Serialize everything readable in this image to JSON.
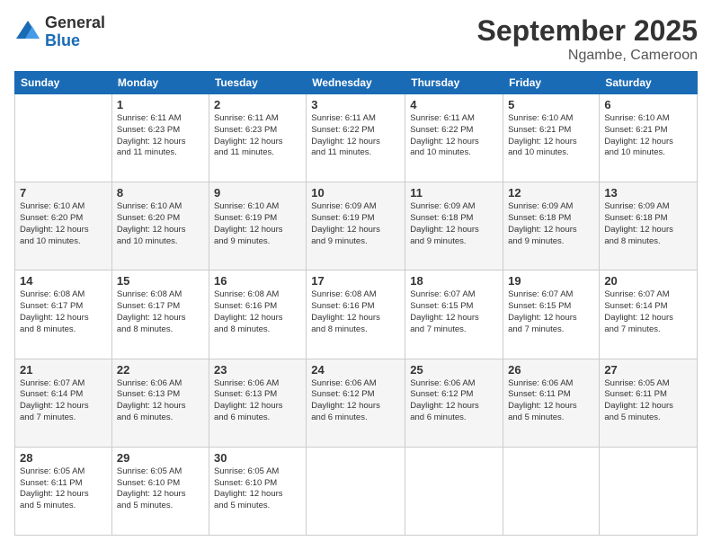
{
  "logo": {
    "general": "General",
    "blue": "Blue"
  },
  "title": "September 2025",
  "location": "Ngambe, Cameroon",
  "days_header": [
    "Sunday",
    "Monday",
    "Tuesday",
    "Wednesday",
    "Thursday",
    "Friday",
    "Saturday"
  ],
  "weeks": [
    [
      {
        "day": "",
        "info": ""
      },
      {
        "day": "1",
        "info": "Sunrise: 6:11 AM\nSunset: 6:23 PM\nDaylight: 12 hours\nand 11 minutes."
      },
      {
        "day": "2",
        "info": "Sunrise: 6:11 AM\nSunset: 6:23 PM\nDaylight: 12 hours\nand 11 minutes."
      },
      {
        "day": "3",
        "info": "Sunrise: 6:11 AM\nSunset: 6:22 PM\nDaylight: 12 hours\nand 11 minutes."
      },
      {
        "day": "4",
        "info": "Sunrise: 6:11 AM\nSunset: 6:22 PM\nDaylight: 12 hours\nand 10 minutes."
      },
      {
        "day": "5",
        "info": "Sunrise: 6:10 AM\nSunset: 6:21 PM\nDaylight: 12 hours\nand 10 minutes."
      },
      {
        "day": "6",
        "info": "Sunrise: 6:10 AM\nSunset: 6:21 PM\nDaylight: 12 hours\nand 10 minutes."
      }
    ],
    [
      {
        "day": "7",
        "info": "Sunrise: 6:10 AM\nSunset: 6:20 PM\nDaylight: 12 hours\nand 10 minutes."
      },
      {
        "day": "8",
        "info": "Sunrise: 6:10 AM\nSunset: 6:20 PM\nDaylight: 12 hours\nand 10 minutes."
      },
      {
        "day": "9",
        "info": "Sunrise: 6:10 AM\nSunset: 6:19 PM\nDaylight: 12 hours\nand 9 minutes."
      },
      {
        "day": "10",
        "info": "Sunrise: 6:09 AM\nSunset: 6:19 PM\nDaylight: 12 hours\nand 9 minutes."
      },
      {
        "day": "11",
        "info": "Sunrise: 6:09 AM\nSunset: 6:18 PM\nDaylight: 12 hours\nand 9 minutes."
      },
      {
        "day": "12",
        "info": "Sunrise: 6:09 AM\nSunset: 6:18 PM\nDaylight: 12 hours\nand 9 minutes."
      },
      {
        "day": "13",
        "info": "Sunrise: 6:09 AM\nSunset: 6:18 PM\nDaylight: 12 hours\nand 8 minutes."
      }
    ],
    [
      {
        "day": "14",
        "info": "Sunrise: 6:08 AM\nSunset: 6:17 PM\nDaylight: 12 hours\nand 8 minutes."
      },
      {
        "day": "15",
        "info": "Sunrise: 6:08 AM\nSunset: 6:17 PM\nDaylight: 12 hours\nand 8 minutes."
      },
      {
        "day": "16",
        "info": "Sunrise: 6:08 AM\nSunset: 6:16 PM\nDaylight: 12 hours\nand 8 minutes."
      },
      {
        "day": "17",
        "info": "Sunrise: 6:08 AM\nSunset: 6:16 PM\nDaylight: 12 hours\nand 8 minutes."
      },
      {
        "day": "18",
        "info": "Sunrise: 6:07 AM\nSunset: 6:15 PM\nDaylight: 12 hours\nand 7 minutes."
      },
      {
        "day": "19",
        "info": "Sunrise: 6:07 AM\nSunset: 6:15 PM\nDaylight: 12 hours\nand 7 minutes."
      },
      {
        "day": "20",
        "info": "Sunrise: 6:07 AM\nSunset: 6:14 PM\nDaylight: 12 hours\nand 7 minutes."
      }
    ],
    [
      {
        "day": "21",
        "info": "Sunrise: 6:07 AM\nSunset: 6:14 PM\nDaylight: 12 hours\nand 7 minutes."
      },
      {
        "day": "22",
        "info": "Sunrise: 6:06 AM\nSunset: 6:13 PM\nDaylight: 12 hours\nand 6 minutes."
      },
      {
        "day": "23",
        "info": "Sunrise: 6:06 AM\nSunset: 6:13 PM\nDaylight: 12 hours\nand 6 minutes."
      },
      {
        "day": "24",
        "info": "Sunrise: 6:06 AM\nSunset: 6:12 PM\nDaylight: 12 hours\nand 6 minutes."
      },
      {
        "day": "25",
        "info": "Sunrise: 6:06 AM\nSunset: 6:12 PM\nDaylight: 12 hours\nand 6 minutes."
      },
      {
        "day": "26",
        "info": "Sunrise: 6:06 AM\nSunset: 6:11 PM\nDaylight: 12 hours\nand 5 minutes."
      },
      {
        "day": "27",
        "info": "Sunrise: 6:05 AM\nSunset: 6:11 PM\nDaylight: 12 hours\nand 5 minutes."
      }
    ],
    [
      {
        "day": "28",
        "info": "Sunrise: 6:05 AM\nSunset: 6:11 PM\nDaylight: 12 hours\nand 5 minutes."
      },
      {
        "day": "29",
        "info": "Sunrise: 6:05 AM\nSunset: 6:10 PM\nDaylight: 12 hours\nand 5 minutes."
      },
      {
        "day": "30",
        "info": "Sunrise: 6:05 AM\nSunset: 6:10 PM\nDaylight: 12 hours\nand 5 minutes."
      },
      {
        "day": "",
        "info": ""
      },
      {
        "day": "",
        "info": ""
      },
      {
        "day": "",
        "info": ""
      },
      {
        "day": "",
        "info": ""
      }
    ]
  ]
}
